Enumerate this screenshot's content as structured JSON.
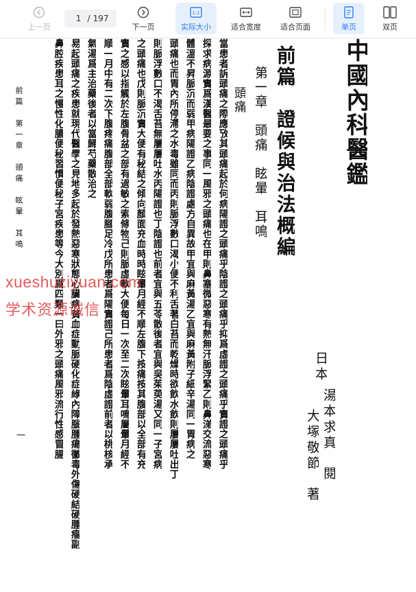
{
  "toolbar": {
    "prev_label": "上一页",
    "next_label": "下一页",
    "current_page": "1",
    "page_sep": "/",
    "total_pages": "197",
    "actual_size_label": "实际大小",
    "fit_width_label": "适合宽度",
    "fit_page_label": "适合页面",
    "single_label": "单页",
    "double_label": "双页",
    "accent_color": "#2f7cf6"
  },
  "book": {
    "title": "中國內科醫鑑",
    "part_title": "前篇　證候與治法概編",
    "chapter_title": "第一章　頭痛　眩暈　耳鳴",
    "section_title": "頭痛",
    "authors": {
      "country": "日本",
      "line1": "湯本求真",
      "line2": "大塚敬節",
      "role_1": "閱",
      "role_2": "著"
    },
    "body_columns": [
      "當患者訴頭痛之際應攷其頭痛起於何病陽證之頭痛乎陰證之頭痛乎抑爲虛證之頭痛乎實證之頭痛乎",
      "探求病源實爲漢醫最要之事同一風邪之頭痛也在甲則鼻塞微惡寒有熱無汗脈浮緊乙則鼻涕交流惡寒",
      "體溫不昇脈沉而弱甲病陽證乙病陰證處方自異故甲宜與麻黃湯乙宜與麻黃附子細辛湯同一胃病之",
      "頭痛也而胃內所停滯之水毒雖同而丙則脈浮數口渴小便不利舌著白苔而乾燥時欲飲水飲則屢屢吐出丁",
      "則脈浮數口不渴舌苔無屢屢吐水丙陽證也丁陰證也前者宜與五苓散後者宜與吳茱萸湯又同一子宮病",
      "之頭痛也戊則脈沉實大便有秘結之傾向顏面充血時時眩暈月經不順左腹下按痛按其腹部以全部有充",
      "實之感以指觸於左腹骨盆之部有過敏之索條物己則脈虛軟大便每日一次至二次眩暈耳鳴屬暈月經不",
      "順一月中有二次下腹疼痛腹部全部軟弱腹腳足冷戊所患者爲陽實證己所患者爲陰虛證前者以桃核承",
      "氣湯爲主治藥後者以當歸芍藥散治之",
      "易起頭痛之疾患就現代醫學之見地多起於發熱惡寒狀態心臟病貧血症動脈硬化症綠內障腦腫瘍黴毒外傷硬結硬腫瘤副",
      "鼻腔疾患耳之慢性化膿便秘習慣便秘子宮疾患等今大別爲四類一曰外邪之頭痛風邪流行性感冒腸"
    ],
    "margin_text": "前篇　第一章　頭痛　眩暈　耳鳴",
    "page_number": "一"
  },
  "watermark": {
    "line1": "xueshuziyuan.com",
    "line2": "学术资源诚信"
  }
}
